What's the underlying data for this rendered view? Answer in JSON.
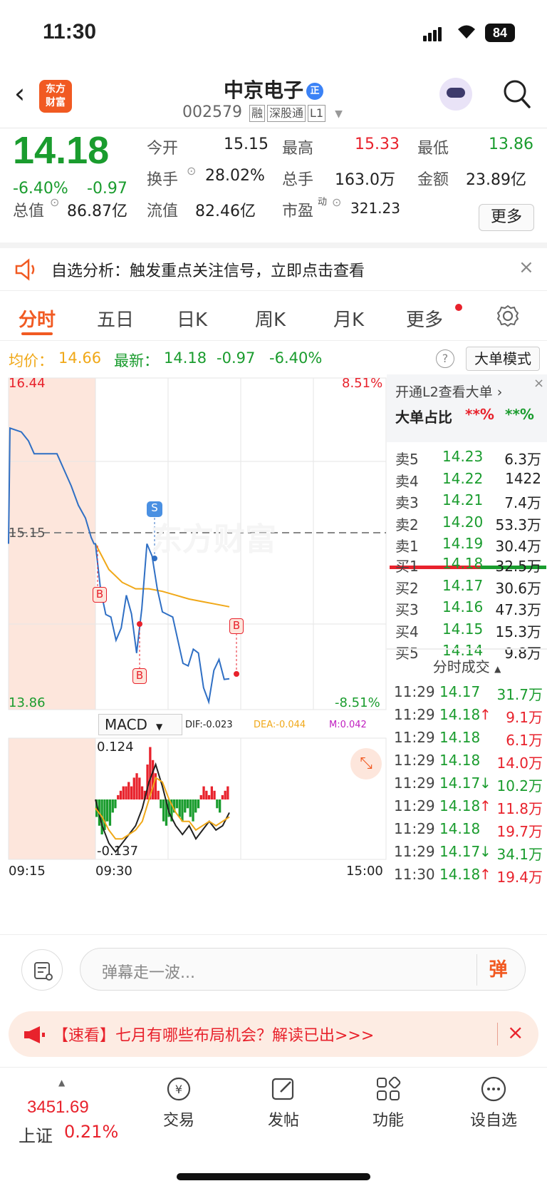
{
  "status": {
    "time": "11:30",
    "battery": "84"
  },
  "header": {
    "back_icon": "chevron-left-icon",
    "logo_line1": "东方",
    "logo_line2": "财富",
    "name": "中京电子",
    "name_badge": "正",
    "code": "002579",
    "tags": [
      "融",
      "深股通",
      "L1"
    ]
  },
  "quote": {
    "price": "14.18",
    "change_pct": "-6.40%",
    "change": "-0.97",
    "open_label": "今开",
    "open": "15.15",
    "high_label": "最高",
    "high": "15.33",
    "low_label": "最低",
    "low": "13.86",
    "turnover_label": "换手",
    "turnover": "28.02%",
    "volume_label": "总手",
    "volume": "163.0万",
    "amount_label": "金额",
    "amount": "23.89亿",
    "mktcap_label": "总值",
    "mktcap": "86.87亿",
    "float_label": "流值",
    "float": "82.46亿",
    "pe_label": "市盈",
    "pe_sup": "动",
    "pe": "321.23",
    "more": "更多"
  },
  "banner": {
    "text": "自选分析：触发重点关注信号，立即点击查看",
    "close": "×"
  },
  "tabs": [
    "分时",
    "五日",
    "日K",
    "周K",
    "月K",
    "更多"
  ],
  "info": {
    "avg_label": "均价：",
    "avg": "14.66",
    "latest_label": "最新：",
    "latest": "14.18",
    "change": "-0.97",
    "pct": "-6.40%",
    "help": "?",
    "big_order_mode": "大单模式"
  },
  "chart_labels": {
    "top_price": "16.44",
    "top_pct": "8.51%",
    "mid_price": "15.15",
    "bot_price": "13.86",
    "bot_pct": "-8.51%",
    "macd_btn": "MACD",
    "dif": "DIF:-0.023",
    "dea": "DEA:-0.044",
    "m": "M:0.042",
    "macd_top": "0.124",
    "macd_bot": "-0.137",
    "t_start": "09:15",
    "t_open": "09:30",
    "t_end": "15:00",
    "marker_s": "S",
    "marker_b": "B",
    "watermark": "东方财富"
  },
  "chart_data": {
    "type": "line",
    "title": "",
    "x": [
      "09:15",
      "09:30",
      "15:00"
    ],
    "ylim": [
      13.86,
      16.44
    ],
    "series": [
      {
        "values": [
          15.15,
          16.05,
          15.95,
          15.85,
          15.6,
          15.4,
          15.2,
          15.15,
          14.6,
          14.4,
          14.75,
          14.3,
          15.15,
          14.8,
          14.6,
          14.4,
          14.2,
          14.3,
          13.92,
          14.25,
          14.1
        ]
      },
      {
        "values": [
          15.15,
          14.95,
          14.85,
          14.8,
          14.8,
          14.78,
          14.75,
          14.72,
          14.7,
          14.68,
          14.66
        ]
      }
    ],
    "macd_ylim": [
      -0.137,
      0.124
    ]
  },
  "level2": {
    "open_l2": "开通L2查看大单 ›",
    "big_ratio_label": "大单占比",
    "big_ratio_red": "**%",
    "big_ratio_green": "**%",
    "asks": [
      {
        "label": "卖5",
        "price": "14.23",
        "vol": "6.3万"
      },
      {
        "label": "卖4",
        "price": "14.22",
        "vol": "1422"
      },
      {
        "label": "卖3",
        "price": "14.21",
        "vol": "7.4万"
      },
      {
        "label": "卖2",
        "price": "14.20",
        "vol": "53.3万"
      },
      {
        "label": "卖1",
        "price": "14.19",
        "vol": "30.4万"
      }
    ],
    "bids": [
      {
        "label": "买1",
        "price": "14.18",
        "vol": "32.5万"
      },
      {
        "label": "买2",
        "price": "14.17",
        "vol": "30.6万"
      },
      {
        "label": "买3",
        "price": "14.16",
        "vol": "47.3万"
      },
      {
        "label": "买4",
        "price": "14.15",
        "vol": "15.3万"
      },
      {
        "label": "买5",
        "price": "14.14",
        "vol": "9.8万"
      }
    ],
    "trades_title": "分时成交",
    "trades": [
      {
        "t": "11:29",
        "p": "14.17",
        "arrow": "",
        "v": "31.7万",
        "c": "green"
      },
      {
        "t": "11:29",
        "p": "14.18",
        "arrow": "↑",
        "v": "9.1万",
        "c": "red"
      },
      {
        "t": "11:29",
        "p": "14.18",
        "arrow": "",
        "v": "6.1万",
        "c": "red"
      },
      {
        "t": "11:29",
        "p": "14.18",
        "arrow": "",
        "v": "14.0万",
        "c": "red"
      },
      {
        "t": "11:29",
        "p": "14.17",
        "arrow": "↓",
        "v": "10.2万",
        "c": "green"
      },
      {
        "t": "11:29",
        "p": "14.18",
        "arrow": "↑",
        "v": "11.8万",
        "c": "red"
      },
      {
        "t": "11:29",
        "p": "14.18",
        "arrow": "",
        "v": "19.7万",
        "c": "red"
      },
      {
        "t": "11:29",
        "p": "14.17",
        "arrow": "↓",
        "v": "34.1万",
        "c": "green"
      },
      {
        "t": "11:30",
        "p": "14.18",
        "arrow": "↑",
        "v": "19.4万",
        "c": "red"
      }
    ]
  },
  "comment": {
    "placeholder": "弹幕走一波...",
    "send": "弹"
  },
  "promo": {
    "text": "【速看】七月有哪些布局机会？解读已出>>>",
    "close": "×"
  },
  "bottom_nav": {
    "index_value": "3451.69",
    "index_name": "上证",
    "index_pct": "0.21%",
    "items": [
      "交易",
      "发帖",
      "功能",
      "设自选"
    ]
  },
  "colors": {
    "up": "#e8222c",
    "down": "#1a9c2e",
    "brand": "#f15a22",
    "line": "#2f6fc4",
    "avg": "#f0a818"
  }
}
